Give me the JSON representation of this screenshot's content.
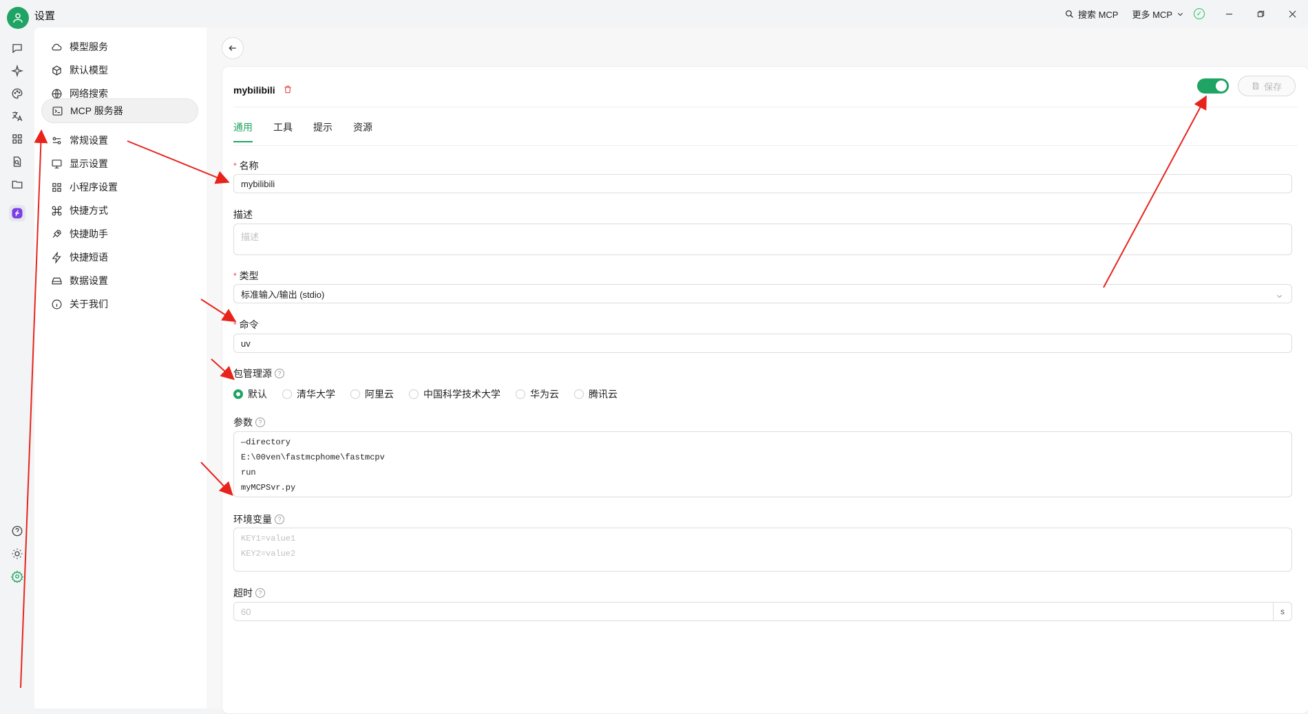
{
  "window": {
    "title": "设置"
  },
  "titlebar": {
    "search_mcp": "搜索 MCP",
    "more_mcp": "更多 MCP"
  },
  "nav": {
    "items": [
      {
        "label": "模型服务",
        "icon": "cloud-icon"
      },
      {
        "label": "默认模型",
        "icon": "cube-icon"
      },
      {
        "label": "网络搜索",
        "icon": "globe-icon"
      },
      {
        "label": "MCP 服务器",
        "icon": "terminal-icon",
        "active": true
      },
      {
        "label": "常规设置",
        "icon": "sliders-icon"
      },
      {
        "label": "显示设置",
        "icon": "monitor-icon"
      },
      {
        "label": "小程序设置",
        "icon": "grid-icon"
      },
      {
        "label": "快捷方式",
        "icon": "command-icon"
      },
      {
        "label": "快捷助手",
        "icon": "rocket-icon"
      },
      {
        "label": "快捷短语",
        "icon": "zap-icon"
      },
      {
        "label": "数据设置",
        "icon": "drive-icon"
      },
      {
        "label": "关于我们",
        "icon": "info-icon"
      }
    ]
  },
  "server": {
    "name": "mybilibili",
    "enabled": true,
    "save_label": "保存",
    "tabs": [
      "通用",
      "工具",
      "提示",
      "资源"
    ],
    "active_tab": "通用"
  },
  "form": {
    "name_label": "名称",
    "name_value": "mybilibili",
    "desc_label": "描述",
    "desc_placeholder": "描述",
    "type_label": "类型",
    "type_value": "标准输入/输出 (stdio)",
    "command_label": "命令",
    "command_value": "uv",
    "registry_label": "包管理源",
    "registry_options": [
      "默认",
      "清华大学",
      "阿里云",
      "中国科学技术大学",
      "华为云",
      "腾讯云"
    ],
    "registry_selected": "默认",
    "args_label": "参数",
    "args_lines": [
      "—directory",
      "E:\\00ven\\fastmcphome\\fastmcpv",
      "run",
      "myMCPSvr.py"
    ],
    "env_label": "环境变量",
    "env_placeholder_lines": [
      "KEY1=value1",
      "KEY2=value2"
    ],
    "timeout_label": "超时",
    "timeout_placeholder": "60",
    "timeout_unit": "s"
  },
  "colors": {
    "accent": "#1fa463",
    "danger": "#e54848",
    "annotation": "#e8231c"
  }
}
